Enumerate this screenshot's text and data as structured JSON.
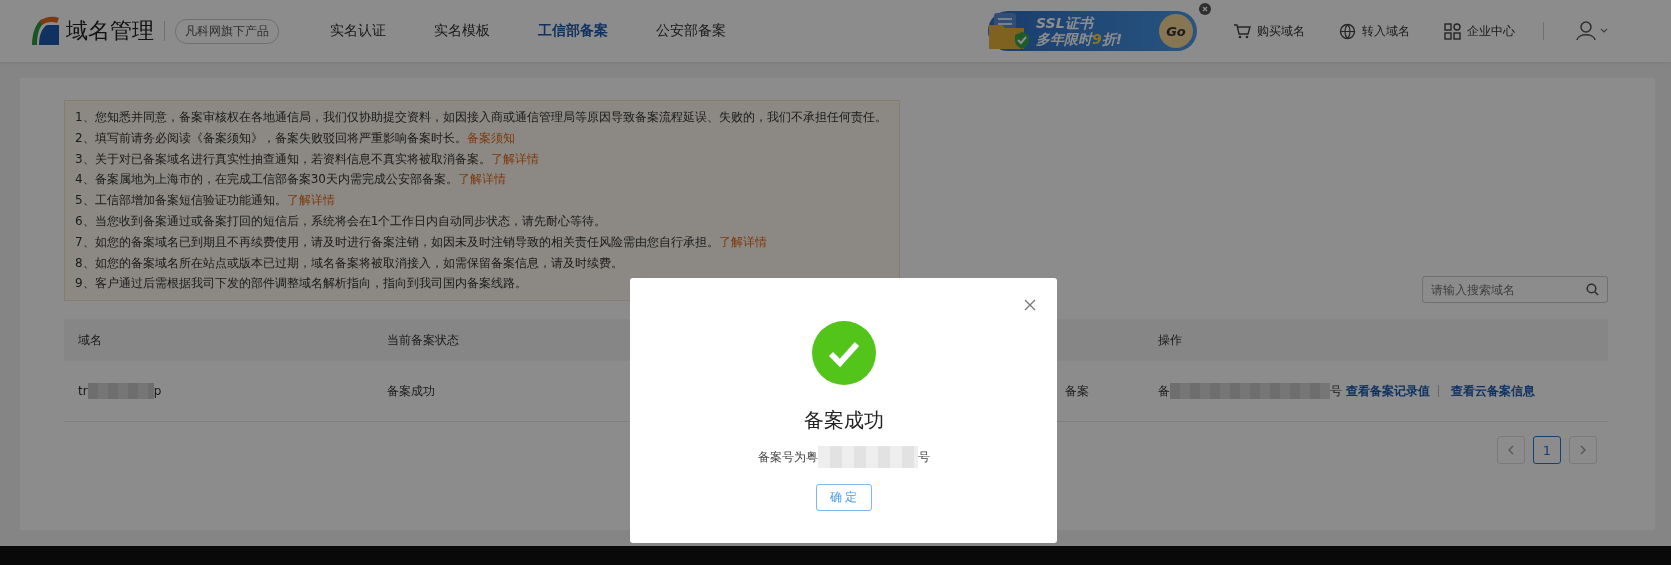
{
  "header": {
    "logo_text": "域名管理",
    "tagline": "凡科网旗下产品",
    "nav": [
      {
        "label": "实名认证",
        "selected": false
      },
      {
        "label": "实名模板",
        "selected": false
      },
      {
        "label": "工信部备案",
        "selected": true
      },
      {
        "label": "公安部备案",
        "selected": false
      }
    ],
    "banner": {
      "line1": "SSL证书",
      "line2": "多年限时**9**折!",
      "button": "Go"
    },
    "actions": [
      {
        "kind": "cart",
        "label": "购买域名"
      },
      {
        "kind": "globe",
        "label": "转入域名"
      },
      {
        "kind": "apps",
        "label": "企业中心"
      }
    ]
  },
  "notices": [
    {
      "text": "1、您知悉并同意，备案审核权在各地通信局，我们仅协助提交资料，如因接入商或通信管理局等原因导致备案流程延误、失败的，我们不承担任何责任。"
    },
    {
      "text": "2、填写前请务必阅读《备案须知》，备案失败驳回将严重影响备案时长。",
      "link": "备案须知"
    },
    {
      "text": "3、关于对已备案域名进行真实性抽查通知，若资料信息不真实将被取消备案。",
      "link": "了解详情"
    },
    {
      "text": "4、备案属地为上海市的，在完成工信部备案30天内需完成公安部备案。",
      "link": "了解详情"
    },
    {
      "text": "5、工信部增加备案短信验证功能通知。",
      "link": "了解详情"
    },
    {
      "text": "6、当您收到备案通过或备案打回的短信后，系统将会在1个工作日内自动同步状态，请先耐心等待。"
    },
    {
      "text": "7、如您的备案域名已到期且不再续费使用，请及时进行备案注销，如因未及时注销导致的相关责任风险需由您自行承担。",
      "link": "了解详情"
    },
    {
      "text": "8、如您的备案域名所在站点或版本已过期，域名备案将被取消接入，如需保留备案信息，请及时续费。"
    },
    {
      "text": "9、客户通过后需根据我司下发的部件调整域名解析指向，指向到我司国内备案线路。"
    }
  ],
  "search": {
    "placeholder": "请输入搜索域名"
  },
  "table": {
    "columns": [
      "域名",
      "当前备案状态",
      "操作"
    ],
    "rows": [
      {
        "domain_start": "tr",
        "domain_end": "p",
        "status": "备案成功",
        "column_4": "备案",
        "record_start": "备",
        "record_end": "号",
        "links": [
          "查看备案记录值",
          "查看云备案信息"
        ]
      }
    ]
  },
  "pagination": {
    "pages": [
      {
        "label": "1",
        "selected": true
      }
    ]
  },
  "dialog": {
    "title": "备案成功",
    "message_start": "备案号为粤",
    "message_end": "号",
    "button": "确 定"
  }
}
